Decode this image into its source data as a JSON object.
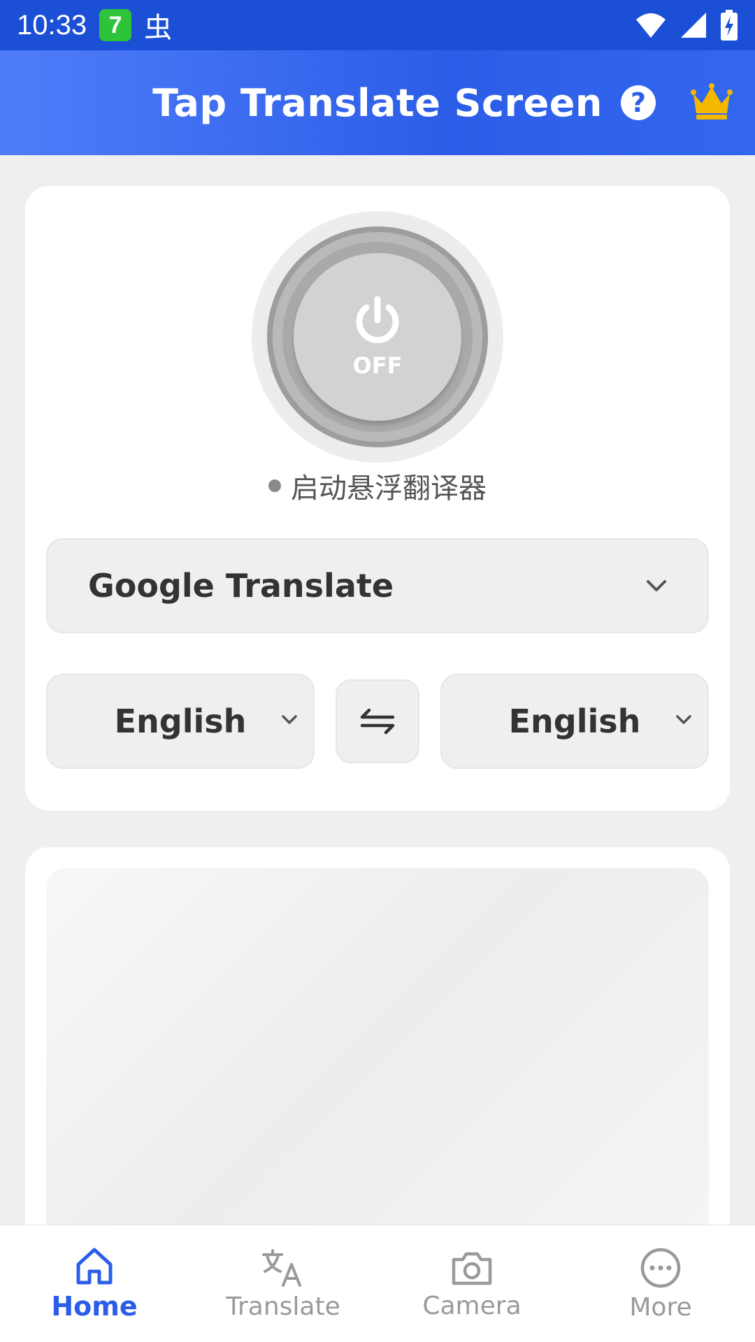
{
  "status_bar": {
    "time": "10:33",
    "badge_text": "7",
    "bug_glyph": "虫"
  },
  "app_bar": {
    "title": "Tap Translate Screen",
    "help_glyph": "?"
  },
  "power": {
    "state_label": "OFF",
    "caption": "启动悬浮翻译器"
  },
  "engine": {
    "selected": "Google Translate"
  },
  "languages": {
    "source": "English",
    "target": "English"
  },
  "nav": {
    "items": [
      {
        "label": "Home",
        "icon": "home-icon"
      },
      {
        "label": "Translate",
        "icon": "translate-icon"
      },
      {
        "label": "Camera",
        "icon": "camera-icon"
      },
      {
        "label": "More",
        "icon": "more-icon"
      }
    ]
  },
  "colors": {
    "primary": "#2c5de8",
    "status_bar": "#1a4fd6",
    "crown": "#f5b800",
    "inactive": "#9a9a9a"
  }
}
